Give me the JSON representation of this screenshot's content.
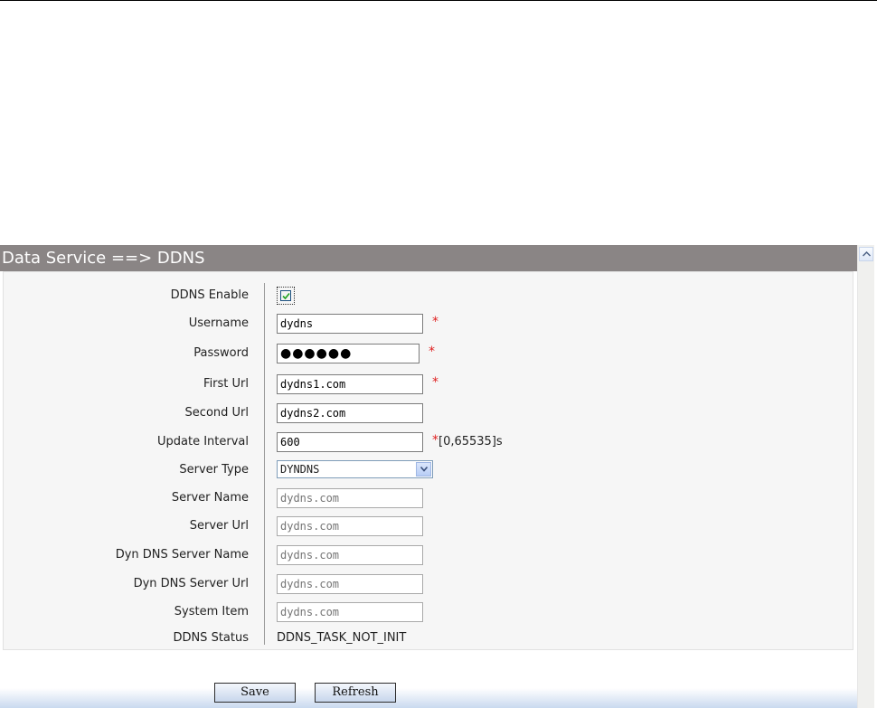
{
  "panel": {
    "title": "Data Service ==> DDNS"
  },
  "form": {
    "ddns_enable": {
      "label": "DDNS Enable",
      "checked": true
    },
    "username": {
      "label": "Username",
      "value": "dydns",
      "required": "*"
    },
    "password": {
      "label": "Password",
      "value": "●●●●●●",
      "required": "*"
    },
    "first_url": {
      "label": "First Url",
      "value": "dydns1.com",
      "required": "*"
    },
    "second_url": {
      "label": "Second Url",
      "value": "dydns2.com"
    },
    "update_interval": {
      "label": "Update Interval",
      "value": "600",
      "required": "*",
      "hint": "[0,65535]s"
    },
    "server_type": {
      "label": "Server Type",
      "value": "DYNDNS"
    },
    "server_name": {
      "label": "Server Name",
      "placeholder": "dydns.com"
    },
    "server_url": {
      "label": "Server Url",
      "placeholder": "dydns.com"
    },
    "dyn_dns_server_name": {
      "label": "Dyn DNS Server Name",
      "placeholder": "dydns.com"
    },
    "dyn_dns_server_url": {
      "label": "Dyn DNS Server Url",
      "placeholder": "dydns.com"
    },
    "system_item": {
      "label": "System Item",
      "placeholder": "dydns.com"
    },
    "ddns_status": {
      "label": "DDNS Status",
      "value": "DDNS_TASK_NOT_INIT"
    }
  },
  "buttons": {
    "save": "Save",
    "refresh": "Refresh"
  },
  "colors": {
    "header_bg": "#8a8585",
    "required": "#e02020",
    "form_bg": "#f6f6f6"
  }
}
